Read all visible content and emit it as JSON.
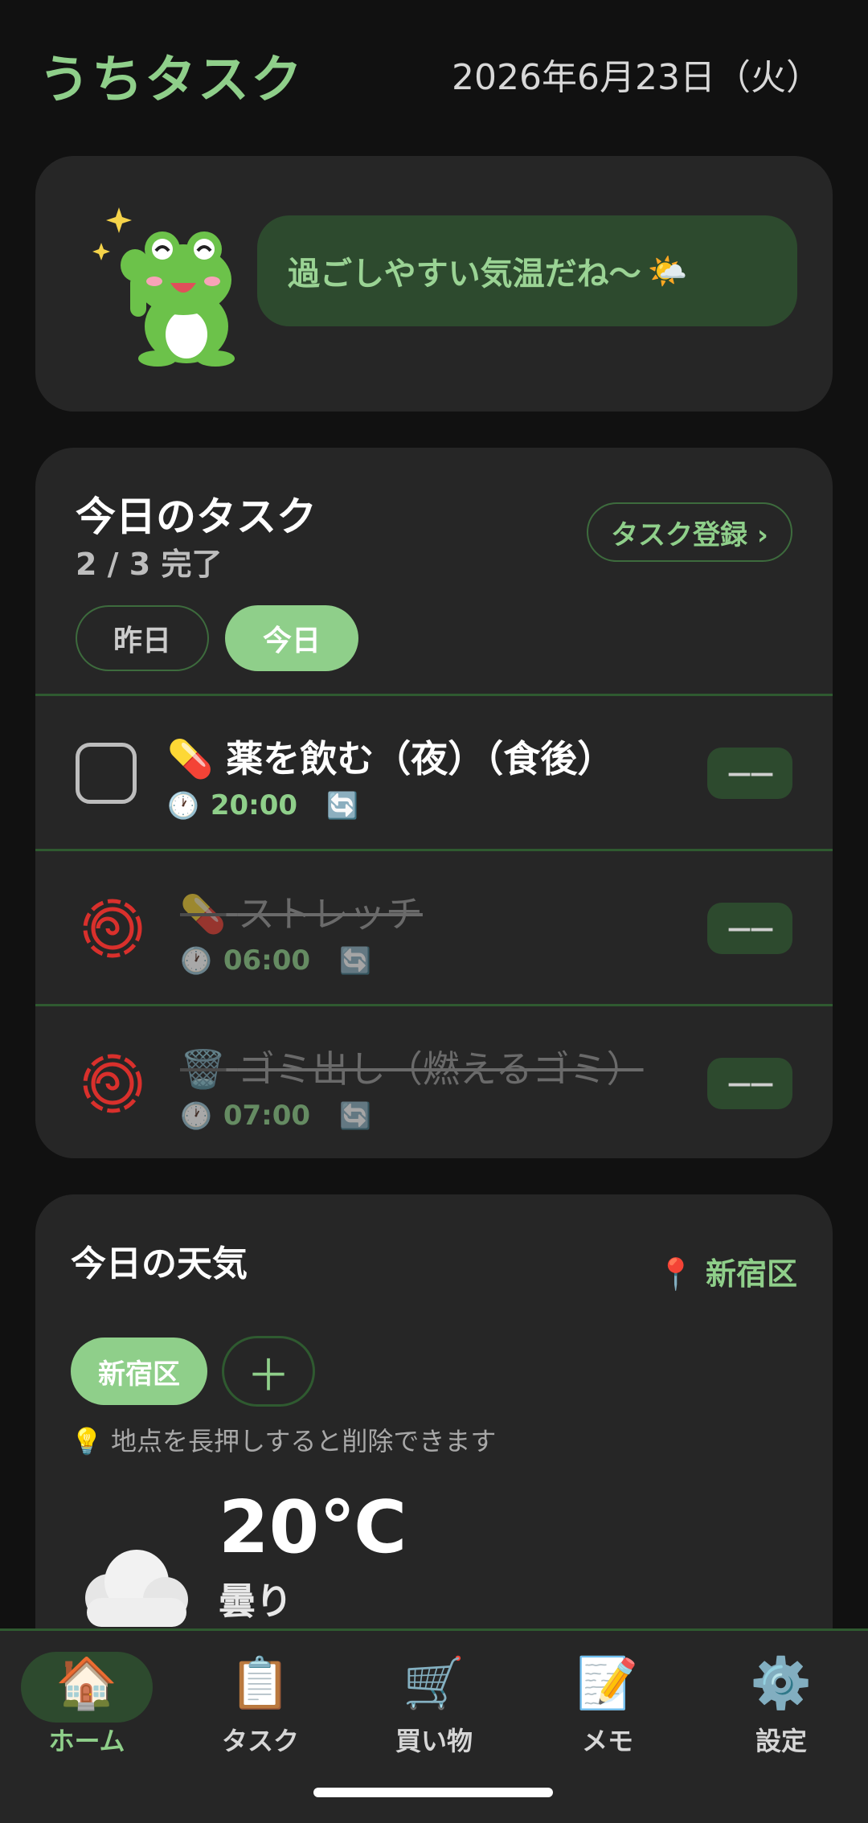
{
  "header": {
    "app_title": "うちタスク",
    "date": "2026年6月23日（火）"
  },
  "mascot": {
    "message": "過ごしやすい気温だね〜",
    "message_icon": "sun-behind-cloud-icon"
  },
  "tasks": {
    "title": "今日のタスク",
    "progress": "2 / 3 完了",
    "register_label": "タスク登録 ›",
    "tabs": [
      "昨日",
      "今日"
    ],
    "active_tab": "今日",
    "items": [
      {
        "icon": "💊",
        "name": "薬を飲む（夜）（食後）",
        "time": "20:00",
        "done": false,
        "action": "——"
      },
      {
        "icon": "💊",
        "name": "ストレッチ",
        "time": "06:00",
        "done": true,
        "action": "——"
      },
      {
        "icon": "🗑️",
        "name": "ゴミ出し（燃えるゴミ）",
        "time": "07:00",
        "done": true,
        "action": "——"
      }
    ]
  },
  "weather": {
    "title": "今日の天気",
    "location": "新宿区",
    "chips": [
      "新宿区"
    ],
    "add_label": "＋",
    "hint": "地点を長押しすると削除できます",
    "temperature": "20℃",
    "condition": "曇り"
  },
  "nav": {
    "items": [
      {
        "icon": "🏠",
        "label": "ホーム",
        "active": true
      },
      {
        "icon": "📋",
        "label": "タスク",
        "active": false
      },
      {
        "icon": "🛒",
        "label": "買い物",
        "active": false
      },
      {
        "icon": "📝",
        "label": "メモ",
        "active": false
      },
      {
        "icon": "⚙️",
        "label": "設定",
        "active": false
      }
    ]
  },
  "colors": {
    "accent": "#8fcf8a",
    "background": "#111111",
    "card": "#262626",
    "done_mark": "#d9302c"
  }
}
